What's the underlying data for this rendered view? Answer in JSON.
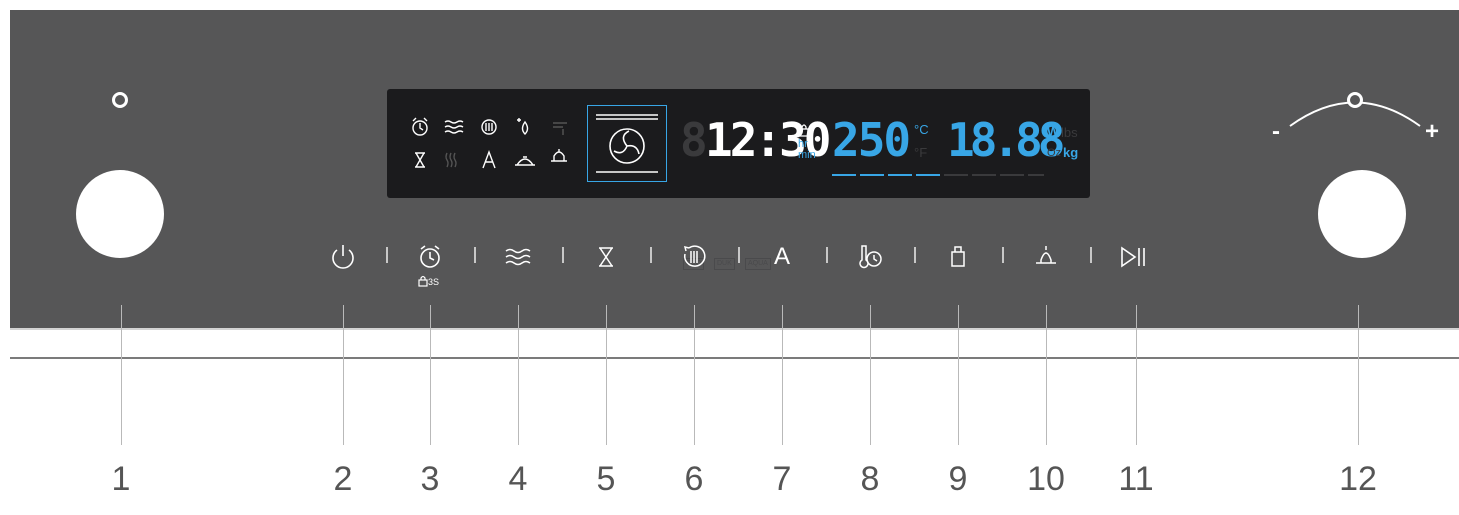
{
  "labels": [
    "1",
    "2",
    "3",
    "4",
    "5",
    "6",
    "7",
    "8",
    "9",
    "10",
    "11",
    "12"
  ],
  "display": {
    "time": "12:30",
    "time_unit_hr": "hr",
    "time_unit_min": "min",
    "temperature": "250",
    "temp_unit_c": "°C",
    "temp_unit_f": "°F",
    "weight": "18.88",
    "weight_unit_w": "W",
    "weight_unit_lbs": "lbs",
    "weight_unit_oz": "Oz",
    "weight_unit_kg": "kg",
    "mode_tags": [
      "ECO",
      "DUK",
      "AQUA"
    ],
    "temp_ghost": "888",
    "time_ghost": "8"
  },
  "buttons": {
    "key_lock_hint": "3S",
    "auto_label": "A"
  },
  "knob_right": {
    "minus": "-",
    "plus": "+"
  },
  "colors": {
    "panel": "#565657",
    "display_bg": "#1b1b1d",
    "display_white": "#ffffff",
    "display_blue": "#38a6e6",
    "label_text": "#555555"
  },
  "icons": [
    "power-icon",
    "timer-icon",
    "grill-icon",
    "hourglass-icon",
    "convection-icon",
    "auto-icon",
    "probe-icon",
    "steam-icon",
    "light-icon",
    "play-pause-icon"
  ]
}
